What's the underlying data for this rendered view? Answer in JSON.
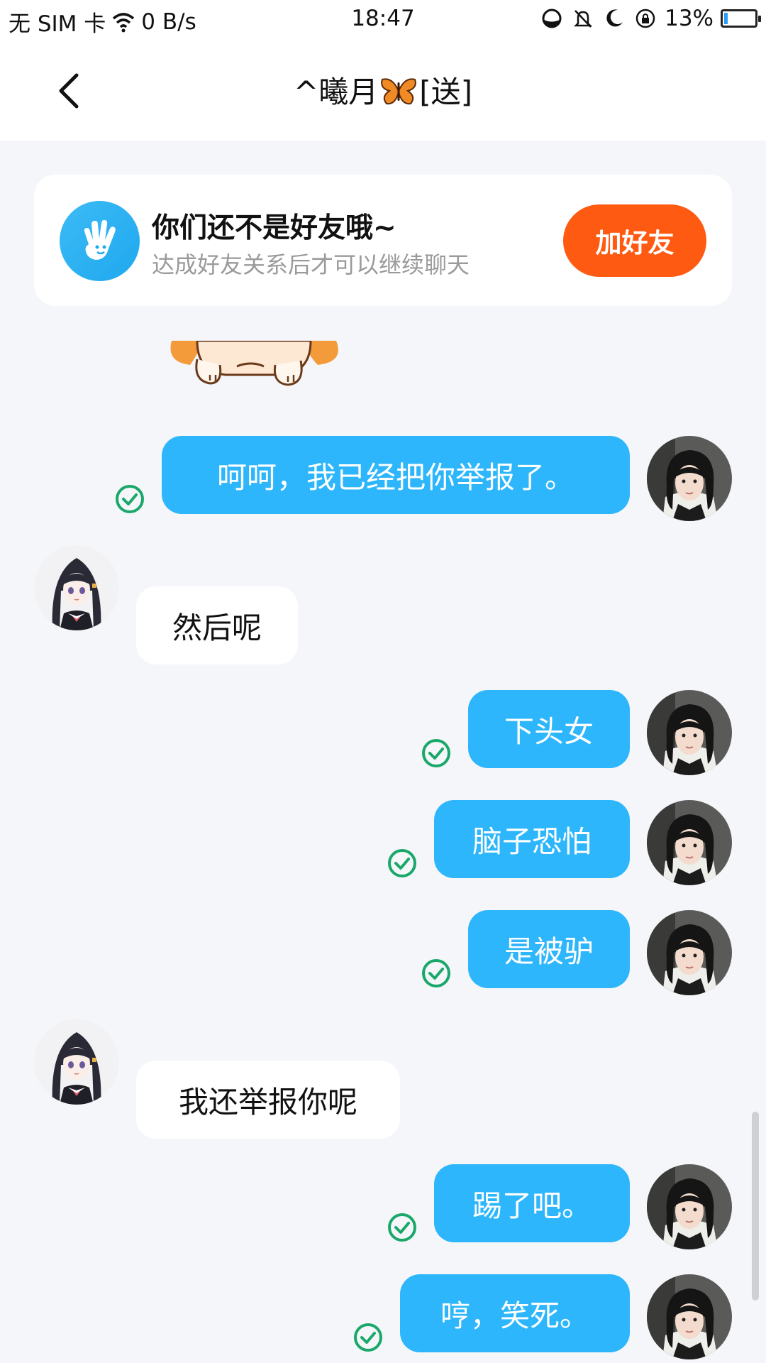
{
  "status_bar": {
    "carrier": "无 SIM 卡",
    "net_speed": "0 B/s",
    "time": "18:47",
    "battery": "13%",
    "battery_level": 0.13
  },
  "nav": {
    "title_prefix": "^曦月",
    "title_suffix": "[送]"
  },
  "friend_card": {
    "title": "你们还不是好友哦~",
    "subtitle": "达成好友关系后才可以继续聊天",
    "add_button": "加好友"
  },
  "messages": [
    {
      "dir": "out",
      "text": "呵呵，我已经把你举报了。"
    },
    {
      "dir": "in",
      "text": "然后呢"
    },
    {
      "dir": "out",
      "text": "下头女"
    },
    {
      "dir": "out",
      "text": "脑子恐怕"
    },
    {
      "dir": "out",
      "text": "是被驴"
    },
    {
      "dir": "in",
      "text": "我还举报你呢"
    },
    {
      "dir": "out",
      "text": "踢了吧。"
    },
    {
      "dir": "out",
      "text": "哼，笑死。"
    }
  ],
  "colors": {
    "outgoing_bubble": "#2db6fb",
    "add_button": "#ff5a12",
    "read_check": "#1aa86a"
  }
}
